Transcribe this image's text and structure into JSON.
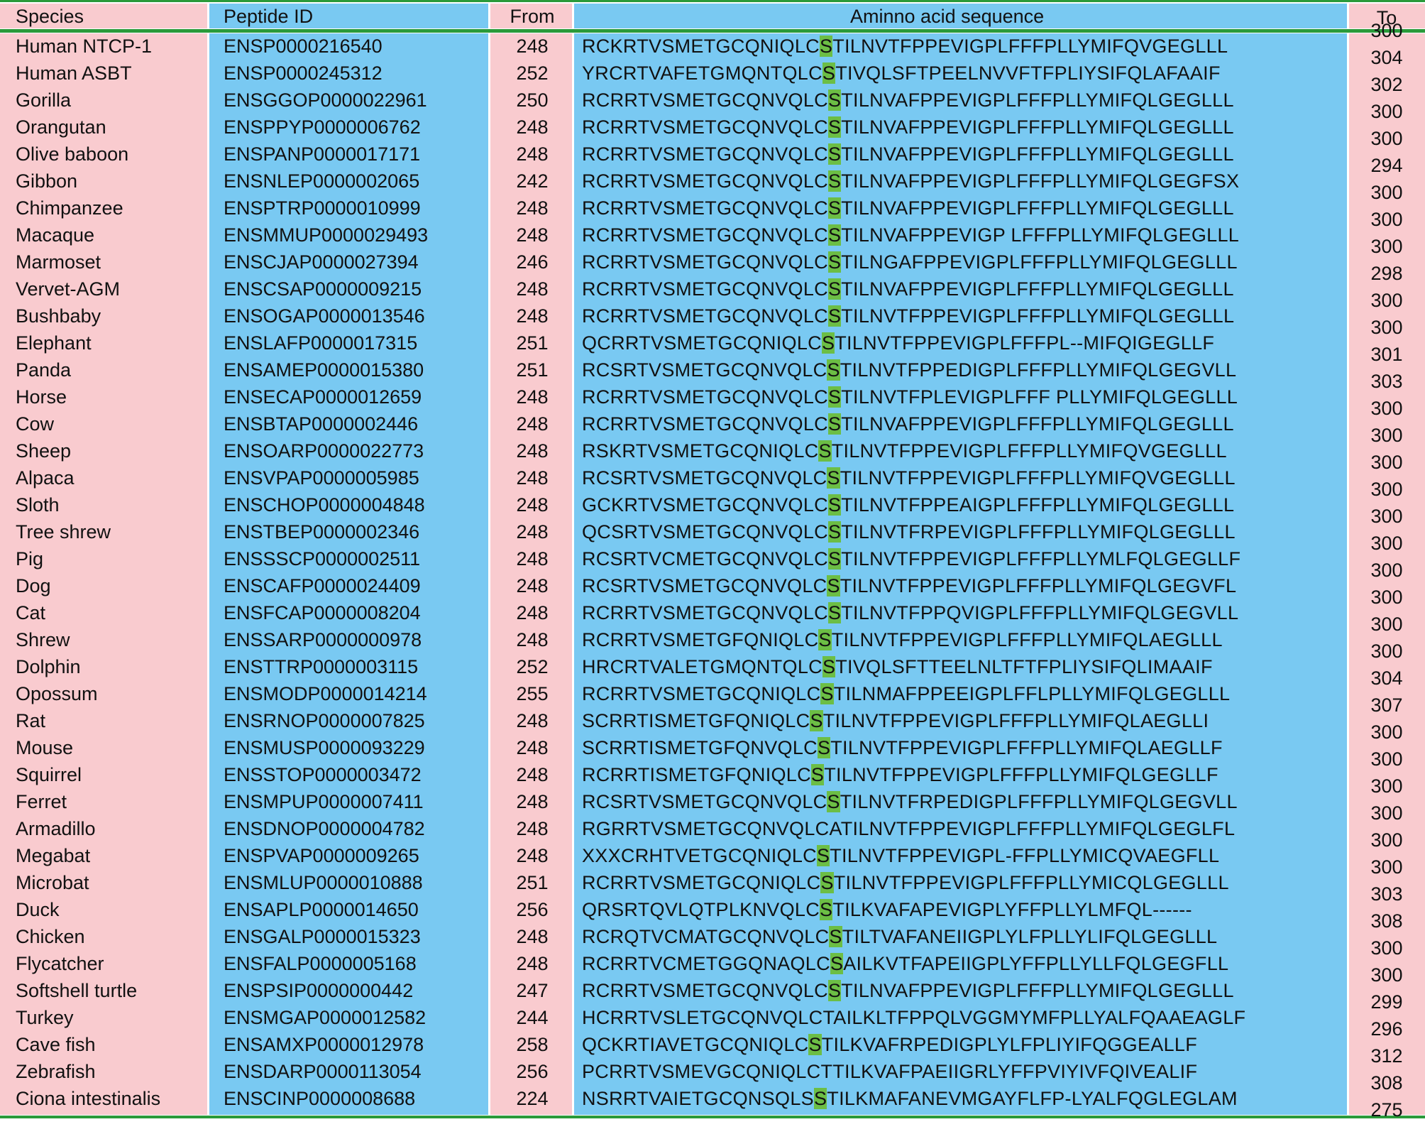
{
  "headers": {
    "species": "Species",
    "peptide_id": "Peptide ID",
    "from": "From",
    "sequence": "Aminno acid sequence",
    "to": "To"
  },
  "colors": {
    "pink": "#f9cbcf",
    "blue": "#79c9f2",
    "highlight": "#6cbe45",
    "rule": "#2a9a3a"
  },
  "rows": [
    {
      "species": "Human NTCP-1",
      "pid": "ENSP0000216540",
      "from": "248",
      "seq_pre": "RCKRTVSMETGCQNIQLC",
      "seq_hi": "S",
      "seq_post": "TILNVTFPPEVIGPLFFFPLLYMIFQVGEGLLL",
      "to": "300"
    },
    {
      "species": "Human ASBT",
      "pid": "ENSP0000245312",
      "from": "252",
      "seq_pre": "YRCRTVAFETGMQNTQLC",
      "seq_hi": "S",
      "seq_post": "TIVQLSFTPEELNVVFTFPLIYSIFQLAFAAIF",
      "to": "304"
    },
    {
      "species": "Gorilla",
      "pid": "ENSGGOP0000022961",
      "from": "250",
      "seq_pre": "RCRRTVSMETGCQNVQLC",
      "seq_hi": "S",
      "seq_post": "TILNVAFPPEVIGPLFFFPLLYMIFQLGEGLLL",
      "to": "302"
    },
    {
      "species": "Orangutan",
      "pid": "ENSPPYP0000006762",
      "from": "248",
      "seq_pre": "RCRRTVSMETGCQNVQLC",
      "seq_hi": "S",
      "seq_post": "TILNVAFPPEVIGPLFFFPLLYMIFQLGEGLLL",
      "to": "300"
    },
    {
      "species": "Olive baboon",
      "pid": "ENSPANP0000017171",
      "from": "248",
      "seq_pre": "RCRRTVSMETGCQNVQLC",
      "seq_hi": "S",
      "seq_post": "TILNVAFPPEVIGPLFFFPLLYMIFQLGEGLLL",
      "to": "300"
    },
    {
      "species": "Gibbon",
      "pid": "ENSNLEP0000002065",
      "from": "242",
      "seq_pre": "RCRRTVSMETGCQNVQLC",
      "seq_hi": "S",
      "seq_post": "TILNVAFPPEVIGPLFFFPLLYMIFQLGEGFSX",
      "to": "294"
    },
    {
      "species": "Chimpanzee",
      "pid": "ENSPTRP0000010999",
      "from": "248",
      "seq_pre": "RCRRTVSMETGCQNVQLC",
      "seq_hi": "S",
      "seq_post": "TILNVAFPPEVIGPLFFFPLLYMIFQLGEGLLL",
      "to": "300"
    },
    {
      "species": "Macaque",
      "pid": "ENSMMUP0000029493",
      "from": "248",
      "seq_pre": "RCRRTVSMETGCQNVQLC",
      "seq_hi": "S",
      "seq_post": "TILNVAFPPEVIGP LFFFPLLYMIFQLGEGLLL",
      "to": "300"
    },
    {
      "species": "Marmoset",
      "pid": "ENSCJAP0000027394",
      "from": "246",
      "seq_pre": "RCRRTVSMETGCQNVQLC",
      "seq_hi": "S",
      "seq_post": "TILNGAFPPEVIGPLFFFPLLYMIFQLGEGLLL",
      "to": "300"
    },
    {
      "species": "Vervet-AGM",
      "pid": "ENSCSAP0000009215",
      "from": "248",
      "seq_pre": "RCRRTVSMETGCQNVQLC",
      "seq_hi": "S",
      "seq_post": "TILNVAFPPEVIGPLFFFPLLYMIFQLGEGLLL",
      "to": "298"
    },
    {
      "species": "Bushbaby",
      "pid": "ENSOGAP0000013546",
      "from": "248",
      "seq_pre": "RCRRTVSMETGCQNVQLC",
      "seq_hi": "S",
      "seq_post": "TILNVTFPPEVIGPLFFFPLLYMIFQLGEGLLL",
      "to": "300"
    },
    {
      "species": "Elephant",
      "pid": "ENSLAFP0000017315",
      "from": "251",
      "seq_pre": "QCRRTVSMETGCQNIQLC",
      "seq_hi": "S",
      "seq_post": "TILNVTFPPEVIGPLFFFPL--MIFQIGEGLLF",
      "to": "300"
    },
    {
      "species": "Panda",
      "pid": "ENSAMEP0000015380",
      "from": "251",
      "seq_pre": "RCSRTVSMETGCQNVQLC",
      "seq_hi": "S",
      "seq_post": "TILNVTFPPEDIGPLFFFPLLYMIFQLGEGVLL",
      "to": "301"
    },
    {
      "species": "Horse",
      "pid": "ENSECAP0000012659",
      "from": "248",
      "seq_pre": "RCRRTVSMETGCQNVQLC",
      "seq_hi": "S",
      "seq_post": "TILNVTFPLEVIGPLFFF PLLYMIFQLGEGLLL",
      "to": "303"
    },
    {
      "species": "Cow",
      "pid": "ENSBTAP0000002446",
      "from": "248",
      "seq_pre": "RCRRTVSMETGCQNVQLC",
      "seq_hi": "S",
      "seq_post": "TILNVAFPPEVIGPLFFFPLLYMIFQLGEGLLL",
      "to": "300"
    },
    {
      "species": "Sheep",
      "pid": "ENSOARP0000022773",
      "from": "248",
      "seq_pre": "RSKRTVSMETGCQNIQLC",
      "seq_hi": "S",
      "seq_post": "TILNVTFPPEVIGPLFFFPLLYMIFQVGEGLLL",
      "to": "300"
    },
    {
      "species": "Alpaca",
      "pid": "ENSVPAP0000005985",
      "from": "248",
      "seq_pre": "RCSRTVSMETGCQNVQLC",
      "seq_hi": "S",
      "seq_post": "TILNVTFPPEVIGPLFFFPLLYMIFQVGEGLLL",
      "to": "300"
    },
    {
      "species": "Sloth",
      "pid": "ENSCHOP0000004848",
      "from": "248",
      "seq_pre": "GCKRTVSMETGCQNVQLC",
      "seq_hi": "S",
      "seq_post": "TILNVTFPPEAIGPLFFFPLLYMIFQLGEGLLL",
      "to": "300"
    },
    {
      "species": "Tree shrew",
      "pid": "ENSTBEP0000002346",
      "from": "248",
      "seq_pre": "QCSRTVSMETGCQNVQLC",
      "seq_hi": "S",
      "seq_post": "TILNVTFRPEVIGPLFFFPLLYMIFQLGEGLLL",
      "to": "300"
    },
    {
      "species": "Pig",
      "pid": "ENSSSCP0000002511",
      "from": "248",
      "seq_pre": "RCSRTVCMETGCQNVQLC",
      "seq_hi": "S",
      "seq_post": "TILNVTFPPEVIGPLFFFPLLYMLFQLGEGLLF",
      "to": "300"
    },
    {
      "species": "Dog",
      "pid": "ENSCAFP0000024409",
      "from": "248",
      "seq_pre": "RCSRTVSMETGCQNVQLC",
      "seq_hi": "S",
      "seq_post": "TILNVTFPPEVIGPLFFFPLLYMIFQLGEGVFL",
      "to": "300"
    },
    {
      "species": "Cat",
      "pid": "ENSFCAP0000008204",
      "from": "248",
      "seq_pre": "RCRRTVSMETGCQNVQLC",
      "seq_hi": "S",
      "seq_post": "TILNVTFPPQVIGPLFFFPLLYMIFQLGEGVLL",
      "to": "300"
    },
    {
      "species": "Shrew",
      "pid": "ENSSARP0000000978",
      "from": "248",
      "seq_pre": "RCRRTVSMETGFQNIQLC",
      "seq_hi": "S",
      "seq_post": "TILNVTFPPEVIGPLFFFPLLYMIFQLAEGLLL",
      "to": "300"
    },
    {
      "species": "Dolphin",
      "pid": "ENSTTRP0000003115",
      "from": "252",
      "seq_pre": "HRCRTVALETGMQNTQLC",
      "seq_hi": "S",
      "seq_post": "TIVQLSFTTEELNLTFTFPLIYSIFQLIMAAIF",
      "to": "300"
    },
    {
      "species": "Opossum",
      "pid": "ENSMODP0000014214",
      "from": "255",
      "seq_pre": "RCRRTVSMETGCQNIQLC",
      "seq_hi": "S",
      "seq_post": "TILNMAFPPEEIGPLFFLPLLYMIFQLGEGLLL",
      "to": "304"
    },
    {
      "species": "Rat",
      "pid": "ENSRNOP0000007825",
      "from": "248",
      "seq_pre": "SCRRTISMETGFQNIQLC",
      "seq_hi": "S",
      "seq_post": "TILNVTFPPEVIGPLFFFPLLYMIFQLAEGLLI",
      "to": "307"
    },
    {
      "species": "Mouse",
      "pid": "ENSMUSP0000093229",
      "from": "248",
      "seq_pre": "SCRRTISMETGFQNVQLC",
      "seq_hi": "S",
      "seq_post": "TILNVTFPPEVIGPLFFFPLLYMIFQLAEGLLF",
      "to": "300"
    },
    {
      "species": "Squirrel",
      "pid": "ENSSTOP0000003472",
      "from": "248",
      "seq_pre": "RCRRTISMETGFQNIQLC",
      "seq_hi": "S",
      "seq_post": "TILNVTFPPEVIGPLFFFPLLYMIFQLGEGLLF",
      "to": "300"
    },
    {
      "species": "Ferret",
      "pid": "ENSMPUP0000007411",
      "from": "248",
      "seq_pre": "RCSRTVSMETGCQNVQLC",
      "seq_hi": "S",
      "seq_post": "TILNVTFRPEDIGPLFFFPLLYMIFQLGEGVLL",
      "to": "300"
    },
    {
      "species": "Armadillo",
      "pid": "ENSDNOP0000004782",
      "from": "248",
      "seq_pre": "RGRRTVSMETGCQNVQLC",
      "seq_hi": "",
      "seq_post": "ATILNVTFPPEVIGPLFFFPLLYMIFQLGEGLFL",
      "to": "300"
    },
    {
      "species": "Megabat",
      "pid": "ENSPVAP0000009265",
      "from": "248",
      "seq_pre": "XXXCRHTVETGCQNIQLC",
      "seq_hi": "S",
      "seq_post": "TILNVTFPPEVIGPL-FFPLLYMICQVAEGFLL",
      "to": "300"
    },
    {
      "species": "Microbat",
      "pid": "ENSMLUP0000010888",
      "from": "251",
      "seq_pre": "RCRRTVSMETGCQNIQLC",
      "seq_hi": "S",
      "seq_post": "TILNVTFPPEVIGPLFFFPLLYMICQLGEGLLL",
      "to": "300"
    },
    {
      "species": "Duck",
      "pid": "ENSAPLP0000014650",
      "from": "256",
      "seq_pre": "QRSRTQVLQTPLKNVQLC",
      "seq_hi": "S",
      "seq_post": "TILKVAFAPEVIGPLYFFPLLYLMFQL------",
      "to": "303"
    },
    {
      "species": "Chicken",
      "pid": "ENSGALP0000015323",
      "from": "248",
      "seq_pre": "RCRQTVCMATGCQNVQLC",
      "seq_hi": "S",
      "seq_post": "TILTVAFANEIIGPLYLFPLLYLIFQLGEGLLL",
      "to": "308"
    },
    {
      "species": "Flycatcher",
      "pid": "ENSFALP0000005168",
      "from": "248",
      "seq_pre": "RCRRTVCMETGGQNAQLC",
      "seq_hi": "S",
      "seq_post": "AILKVTFAPEIIGPLYFFPLLYLLFQLGEGFLL",
      "to": "300"
    },
    {
      "species": "Softshell turtle",
      "pid": "ENSPSIP0000000442",
      "from": "247",
      "seq_pre": "RCRRTVSMETGCQNVQLC",
      "seq_hi": "S",
      "seq_post": "TILNVAFPPEVIGPLFFFPLLYMIFQLGEGLLL",
      "to": "300"
    },
    {
      "species": "Turkey",
      "pid": "ENSMGAP0000012582",
      "from": "244",
      "seq_pre": "HCRRTVSLETGCQNVQLC",
      "seq_hi": "",
      "seq_post": "TAILKLTFPPQLVGGMYMFPLLYALFQAAEAGLF",
      "to": "299"
    },
    {
      "species": "Cave fish",
      "pid": "ENSAMXP0000012978",
      "from": "258",
      "seq_pre": "QCKRTIAVETGCQNIQLC",
      "seq_hi": "S",
      "seq_post": "TILKVAFRPEDIGPLYLFPLIYIFQGGEALLF",
      "to": "296"
    },
    {
      "species": "Zebrafish",
      "pid": "ENSDARP0000113054",
      "from": "256",
      "seq_pre": "PCRRTVSMEVGCQNIQLC",
      "seq_hi": "",
      "seq_post": "TTILKVAFPAEIIGRLYFFPVIYIVFQIVEALIF",
      "to": "312"
    },
    {
      "species": "Ciona intestinalis",
      "pid": "ENSCINP0000008688",
      "from": "224",
      "seq_pre": "NSRRTVAIETGCQNSQLS",
      "seq_hi": "S",
      "seq_post": "TILKMAFANEVMGAYFLFP-LYALFQGLEGLAM",
      "to": "308"
    }
  ],
  "to_last": "275"
}
